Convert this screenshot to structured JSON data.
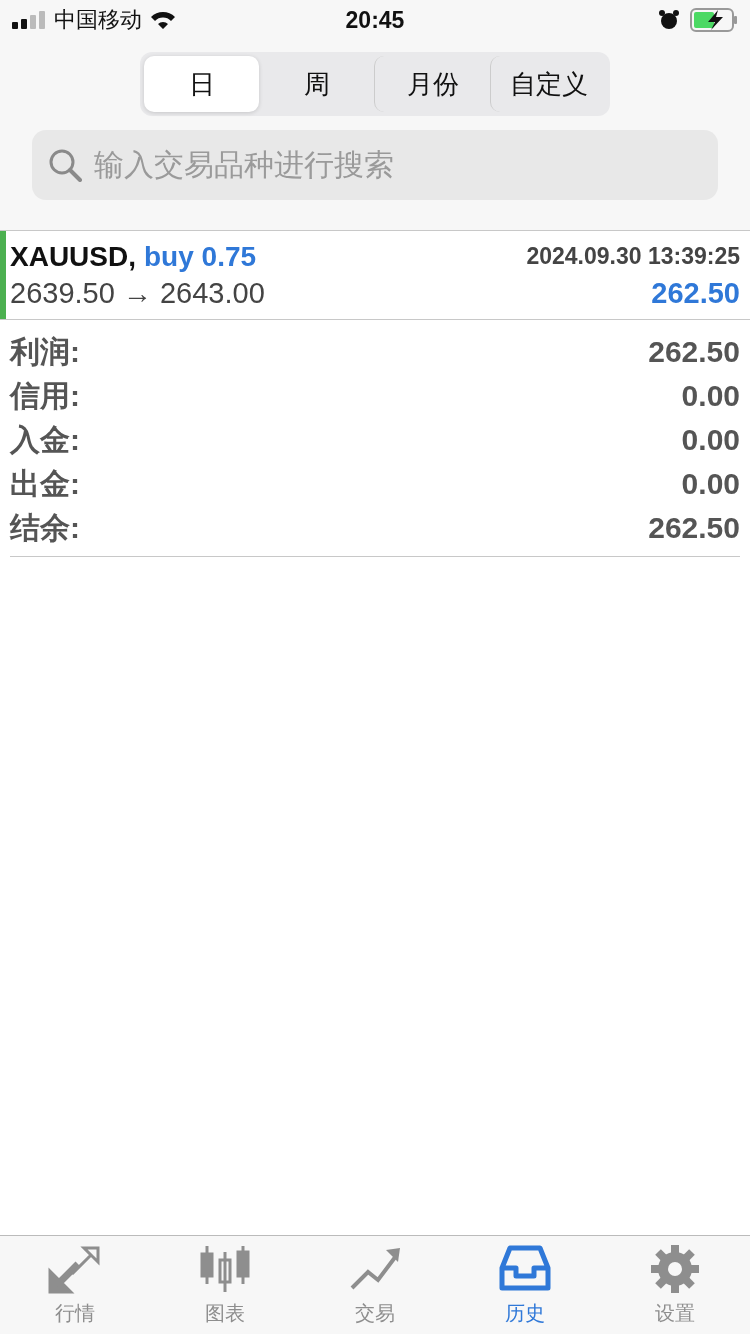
{
  "status_bar": {
    "carrier": "中国移动",
    "time": "20:45"
  },
  "period_tabs": [
    {
      "label": "日",
      "selected": true
    },
    {
      "label": "周",
      "selected": false
    },
    {
      "label": "月份",
      "selected": false
    },
    {
      "label": "自定义",
      "selected": false
    }
  ],
  "search": {
    "placeholder": "输入交易品种进行搜索"
  },
  "trades": [
    {
      "symbol": "XAUUSD,",
      "side": "buy 0.75",
      "prices": "2639.50 → 2643.00",
      "time": "2024.09.30 13:39:25",
      "profit": "262.50",
      "color": "#4cb050"
    }
  ],
  "summary": [
    {
      "label": "利润:",
      "value": "262.50"
    },
    {
      "label": "信用:",
      "value": "0.00"
    },
    {
      "label": "入金:",
      "value": "0.00"
    },
    {
      "label": "出金:",
      "value": "0.00"
    },
    {
      "label": "结余:",
      "value": "262.50"
    }
  ],
  "bottom_tabs": [
    {
      "label": "行情",
      "kind": "quotes",
      "selected": false
    },
    {
      "label": "图表",
      "kind": "chart",
      "selected": false
    },
    {
      "label": "交易",
      "kind": "trade",
      "selected": false
    },
    {
      "label": "历史",
      "kind": "history",
      "selected": true
    },
    {
      "label": "设置",
      "kind": "settings",
      "selected": false
    }
  ]
}
